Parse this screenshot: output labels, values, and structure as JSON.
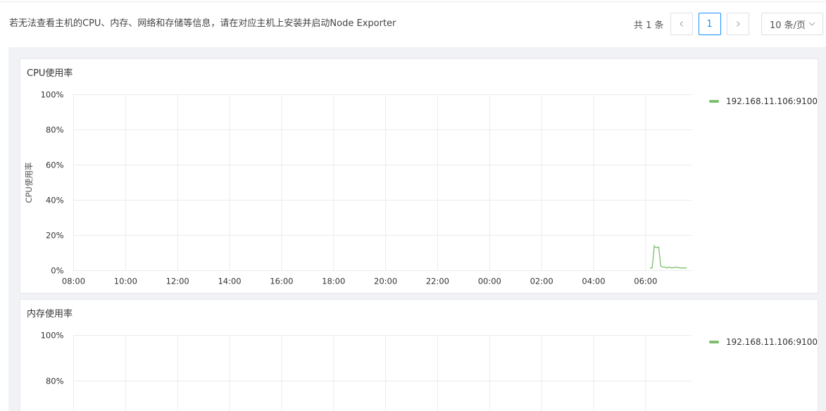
{
  "header": {
    "notice": "若无法查看主机的CPU、内存、网络和存储等信息，请在对应主机上安装并启动Node Exporter"
  },
  "pagination": {
    "total_label": "共 1 条",
    "prev_icon": "chevron-left-icon",
    "current_page": "1",
    "next_icon": "chevron-right-icon",
    "page_size": "10 条/页",
    "page_size_icon": "chevron-down-icon"
  },
  "colors": {
    "series": "#7cbf6b",
    "accent": "#1890ff",
    "grid": "#ebebeb"
  },
  "chart_data": [
    {
      "type": "line",
      "title": "CPU使用率",
      "xlabel": "",
      "ylabel": "CPU使用率",
      "x_ticks": [
        "08:00",
        "10:00",
        "12:00",
        "14:00",
        "16:00",
        "18:00",
        "20:00",
        "22:00",
        "00:00",
        "02:00",
        "04:00",
        "06:00"
      ],
      "y_ticks": [
        "100%",
        "80%",
        "60%",
        "40%",
        "20%",
        "0%"
      ],
      "ylim": [
        0,
        100
      ],
      "grid": true,
      "legend_position": "right",
      "series": [
        {
          "name": "192.168.11.106:9100",
          "x": [
            "06:10",
            "06:15",
            "06:20",
            "06:21",
            "06:25",
            "06:30",
            "06:35",
            "06:40",
            "06:45",
            "06:50",
            "06:55",
            "07:00",
            "07:10",
            "07:20",
            "07:30",
            "07:35"
          ],
          "values": [
            1.5,
            1.5,
            14.0,
            13.5,
            13.0,
            13.5,
            2.5,
            2.0,
            2.0,
            1.5,
            2.0,
            1.5,
            2.0,
            1.5,
            1.5,
            1.5
          ]
        }
      ]
    },
    {
      "type": "line",
      "title": "内存使用率",
      "xlabel": "",
      "ylabel": "",
      "y_ticks": [
        "100%",
        "80%"
      ],
      "ylim": [
        0,
        100
      ],
      "grid": true,
      "legend_position": "right",
      "series": [
        {
          "name": "192.168.11.106:9100",
          "x": [],
          "values": []
        }
      ]
    }
  ]
}
